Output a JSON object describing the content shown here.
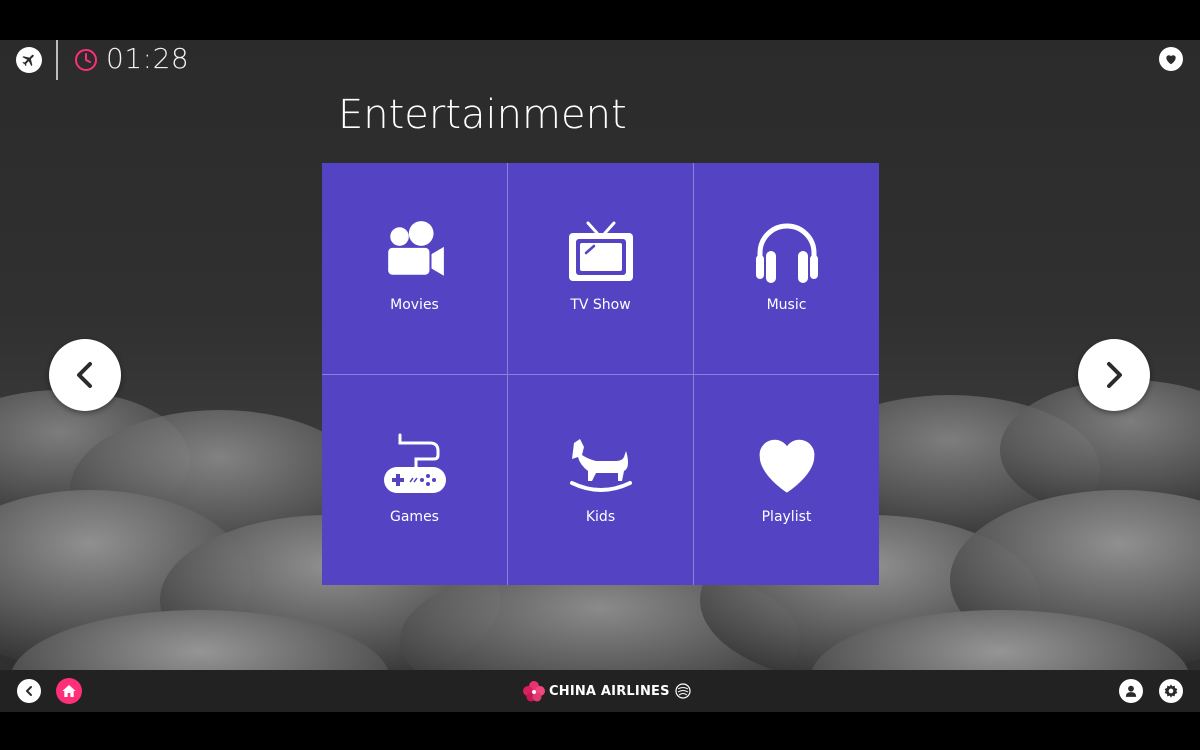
{
  "header": {
    "time": "01:28",
    "title": "Entertainment"
  },
  "tiles": [
    {
      "label": "Movies",
      "icon": "movie-camera-icon"
    },
    {
      "label": "TV Show",
      "icon": "tv-icon"
    },
    {
      "label": "Music",
      "icon": "headphones-icon"
    },
    {
      "label": "Games",
      "icon": "gamepad-icon"
    },
    {
      "label": "Kids",
      "icon": "rocking-horse-icon"
    },
    {
      "label": "Playlist",
      "icon": "heart-icon"
    }
  ],
  "footer": {
    "brand": "CHINA AIRLINES"
  },
  "colors": {
    "tile_bg": "#5443c3",
    "accent_pink": "#ff2f7a",
    "bar_bg": "#222222"
  }
}
